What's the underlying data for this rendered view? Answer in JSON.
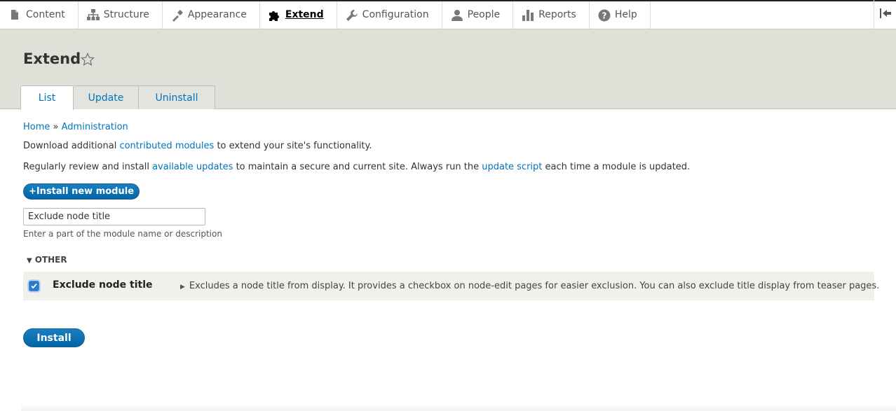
{
  "toolbar": {
    "items": [
      {
        "label": "Content",
        "icon": "page-icon"
      },
      {
        "label": "Structure",
        "icon": "sitemap-icon"
      },
      {
        "label": "Appearance",
        "icon": "paintbrush-icon"
      },
      {
        "label": "Extend",
        "icon": "puzzle-icon"
      },
      {
        "label": "Configuration",
        "icon": "wrench-icon"
      },
      {
        "label": "People",
        "icon": "person-icon"
      },
      {
        "label": "Reports",
        "icon": "bar-chart-icon"
      },
      {
        "label": "Help",
        "icon": "question-icon"
      }
    ],
    "active": "Extend",
    "collapse_icon": "collapse-toolbar-icon"
  },
  "header": {
    "title": "Extend",
    "tabs": [
      {
        "label": "List",
        "active": true
      },
      {
        "label": "Update",
        "active": false
      },
      {
        "label": "Uninstall",
        "active": false
      }
    ]
  },
  "breadcrumb": {
    "home": "Home",
    "separator": "»",
    "admin": "Administration"
  },
  "intro": {
    "p1_before": "Download additional ",
    "p1_link": "contributed modules",
    "p1_after": " to extend your site's functionality.",
    "p2_before": "Regularly review and install ",
    "p2_link1": "available updates",
    "p2_mid": " to maintain a secure and current site. Always run the ",
    "p2_link2": "update script",
    "p2_after": " each time a module is updated."
  },
  "install_new_button": "+Install new module",
  "filter": {
    "value": "Exclude node title",
    "description": "Enter a part of the module name or description"
  },
  "group": {
    "label": "OTHER",
    "modules": [
      {
        "name": "Exclude node title",
        "checked": true,
        "description": "Excludes a node title from display. It provides a checkbox on node-edit pages for easier exclusion. You can also exclude title display from teaser pages."
      }
    ]
  },
  "install_button": "Install",
  "colors": {
    "link": "#0074bd",
    "primary_button": "#0071b8",
    "header_bg": "#e0e0d8"
  }
}
